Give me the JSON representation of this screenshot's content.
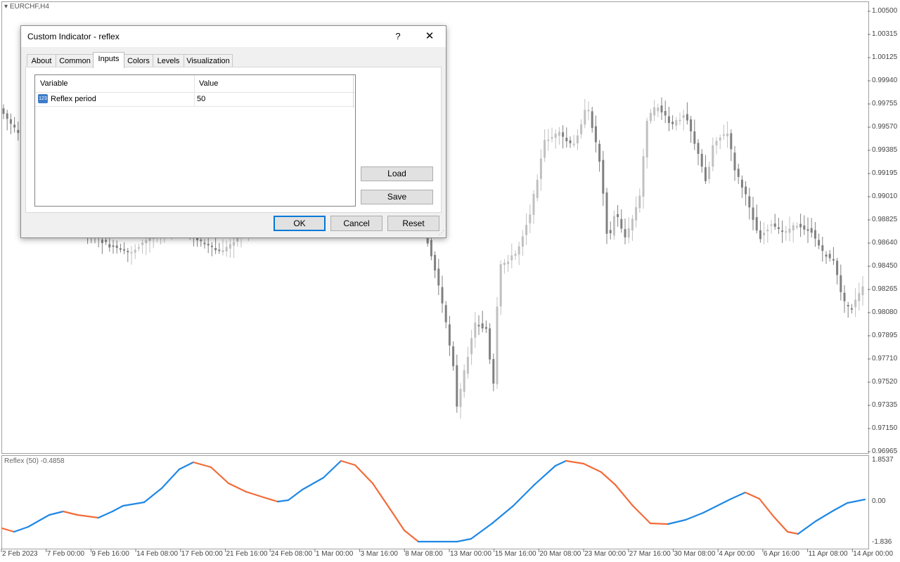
{
  "chart": {
    "symbol_title": "EURCHF,H4",
    "indicator_title": "Reflex (50) -0.4858",
    "price_axis": [
      "1.00500",
      "1.00315",
      "1.00125",
      "0.99940",
      "0.99755",
      "0.99570",
      "0.99385",
      "0.99195",
      "0.99010",
      "0.98825",
      "0.98640",
      "0.98450",
      "0.98265",
      "0.98080",
      "0.97895",
      "0.97710",
      "0.97520",
      "0.97335",
      "0.97150",
      "0.96965"
    ],
    "indicator_axis": [
      "1.8537",
      "0.00",
      "-1.836"
    ],
    "time_axis": [
      "2 Feb 2023",
      "7 Feb 00:00",
      "9 Feb 16:00",
      "14 Feb 08:00",
      "17 Feb 00:00",
      "21 Feb 16:00",
      "24 Feb 08:00",
      "1 Mar 00:00",
      "3 Mar 16:00",
      "8 Mar 08:00",
      "13 Mar 00:00",
      "15 Mar 16:00",
      "20 Mar 08:00",
      "23 Mar 00:00",
      "27 Mar 16:00",
      "30 Mar 08:00",
      "4 Apr 00:00",
      "6 Apr 16:00",
      "11 Apr 08:00",
      "14 Apr 00:00"
    ],
    "colors": {
      "up_line": "#1e88e5",
      "down_line": "#f26b38",
      "candle_bull": "#c0c0c0",
      "candle_bear": "#808080"
    }
  },
  "dialog": {
    "title": "Custom Indicator - reflex",
    "help_label": "?",
    "close_label": "✕",
    "tabs": [
      "About",
      "Common",
      "Inputs",
      "Colors",
      "Levels",
      "Visualization"
    ],
    "active_tab": "Inputs",
    "grid": {
      "headers": [
        "Variable",
        "Value"
      ],
      "rows": [
        {
          "variable": "Reflex period",
          "value": "50",
          "icon": "123"
        }
      ]
    },
    "buttons": {
      "load": "Load",
      "save": "Save",
      "ok": "OK",
      "cancel": "Cancel",
      "reset": "Reset"
    }
  }
}
